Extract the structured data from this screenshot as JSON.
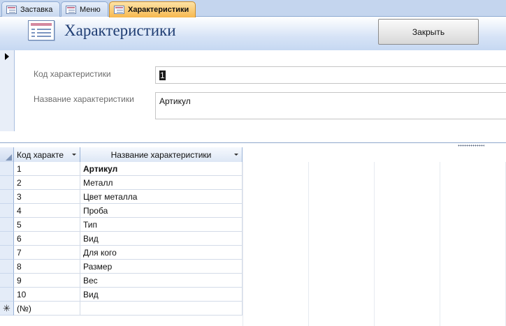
{
  "tabs": [
    {
      "label": "Заставка",
      "active": false
    },
    {
      "label": "Меню",
      "active": false
    },
    {
      "label": "Характеристики",
      "active": true
    }
  ],
  "header": {
    "title": "Характеристики",
    "close_label": "Закрыть"
  },
  "form": {
    "id_label": "Код характеристики",
    "id_value": "1",
    "name_label": "Название характеристики",
    "name_value": "Артикул"
  },
  "datasheet": {
    "columns": [
      "Код характе",
      "Название характеристики"
    ],
    "rows": [
      {
        "id": "1",
        "name": "Артикул"
      },
      {
        "id": "2",
        "name": "Металл"
      },
      {
        "id": "3",
        "name": "Цвет металла"
      },
      {
        "id": "4",
        "name": "Проба"
      },
      {
        "id": "5",
        "name": "Тип"
      },
      {
        "id": "6",
        "name": "Вид"
      },
      {
        "id": "7",
        "name": "Для кого"
      },
      {
        "id": "8",
        "name": "Размер"
      },
      {
        "id": "9",
        "name": "Вес"
      },
      {
        "id": "10",
        "name": "Вид"
      }
    ],
    "new_row_marker": "✳",
    "new_row_placeholder": "(№)"
  },
  "colors": {
    "active_tab": "#f7b84f",
    "header_bg": "#c6d8f2",
    "title_color": "#1f3d73"
  }
}
